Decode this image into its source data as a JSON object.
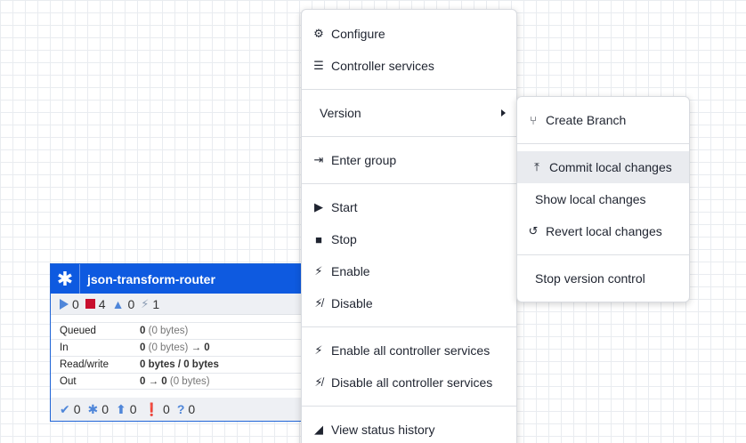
{
  "process_group": {
    "title": "json-transform-router",
    "stats": {
      "running": "0",
      "stopped": "4",
      "invalid": "0",
      "disabled": "1"
    },
    "rows": [
      {
        "label": "Queued",
        "value_bold": "0",
        "value_rest": "(0 bytes)",
        "suffix": ""
      },
      {
        "label": "In",
        "value_bold": "0",
        "value_rest": "(0 bytes)",
        "suffix": "→ 0"
      },
      {
        "label": "Read/write",
        "value_bold": "0 bytes / 0 bytes",
        "value_rest": "",
        "suffix": ""
      },
      {
        "label": "Out",
        "value_bold": "0 → 0",
        "value_rest": "(0 bytes)",
        "suffix": ""
      }
    ],
    "footer": {
      "up_to_date": "0",
      "locally_modified": "0",
      "stale": "0",
      "sync_failure": "0",
      "unknown": "0"
    }
  },
  "context_menu": {
    "items": {
      "configure": "Configure",
      "controller_services": "Controller services",
      "version": "Version",
      "enter_group": "Enter group",
      "start": "Start",
      "stop": "Stop",
      "enable": "Enable",
      "disable": "Disable",
      "enable_all": "Enable all controller services",
      "disable_all": "Disable all controller services",
      "view_status_history": "View status history"
    }
  },
  "version_submenu": {
    "items": {
      "create_branch": "Create Branch",
      "commit_local_changes": "Commit local changes",
      "show_local_changes": "Show local changes",
      "revert_local_changes": "Revert local changes",
      "stop_version_control": "Stop version control"
    }
  },
  "colors": {
    "header": "#0e5ae0",
    "stopped": "#c8102e",
    "accent": "#4f86d9",
    "highlight": "#e9ebef"
  }
}
